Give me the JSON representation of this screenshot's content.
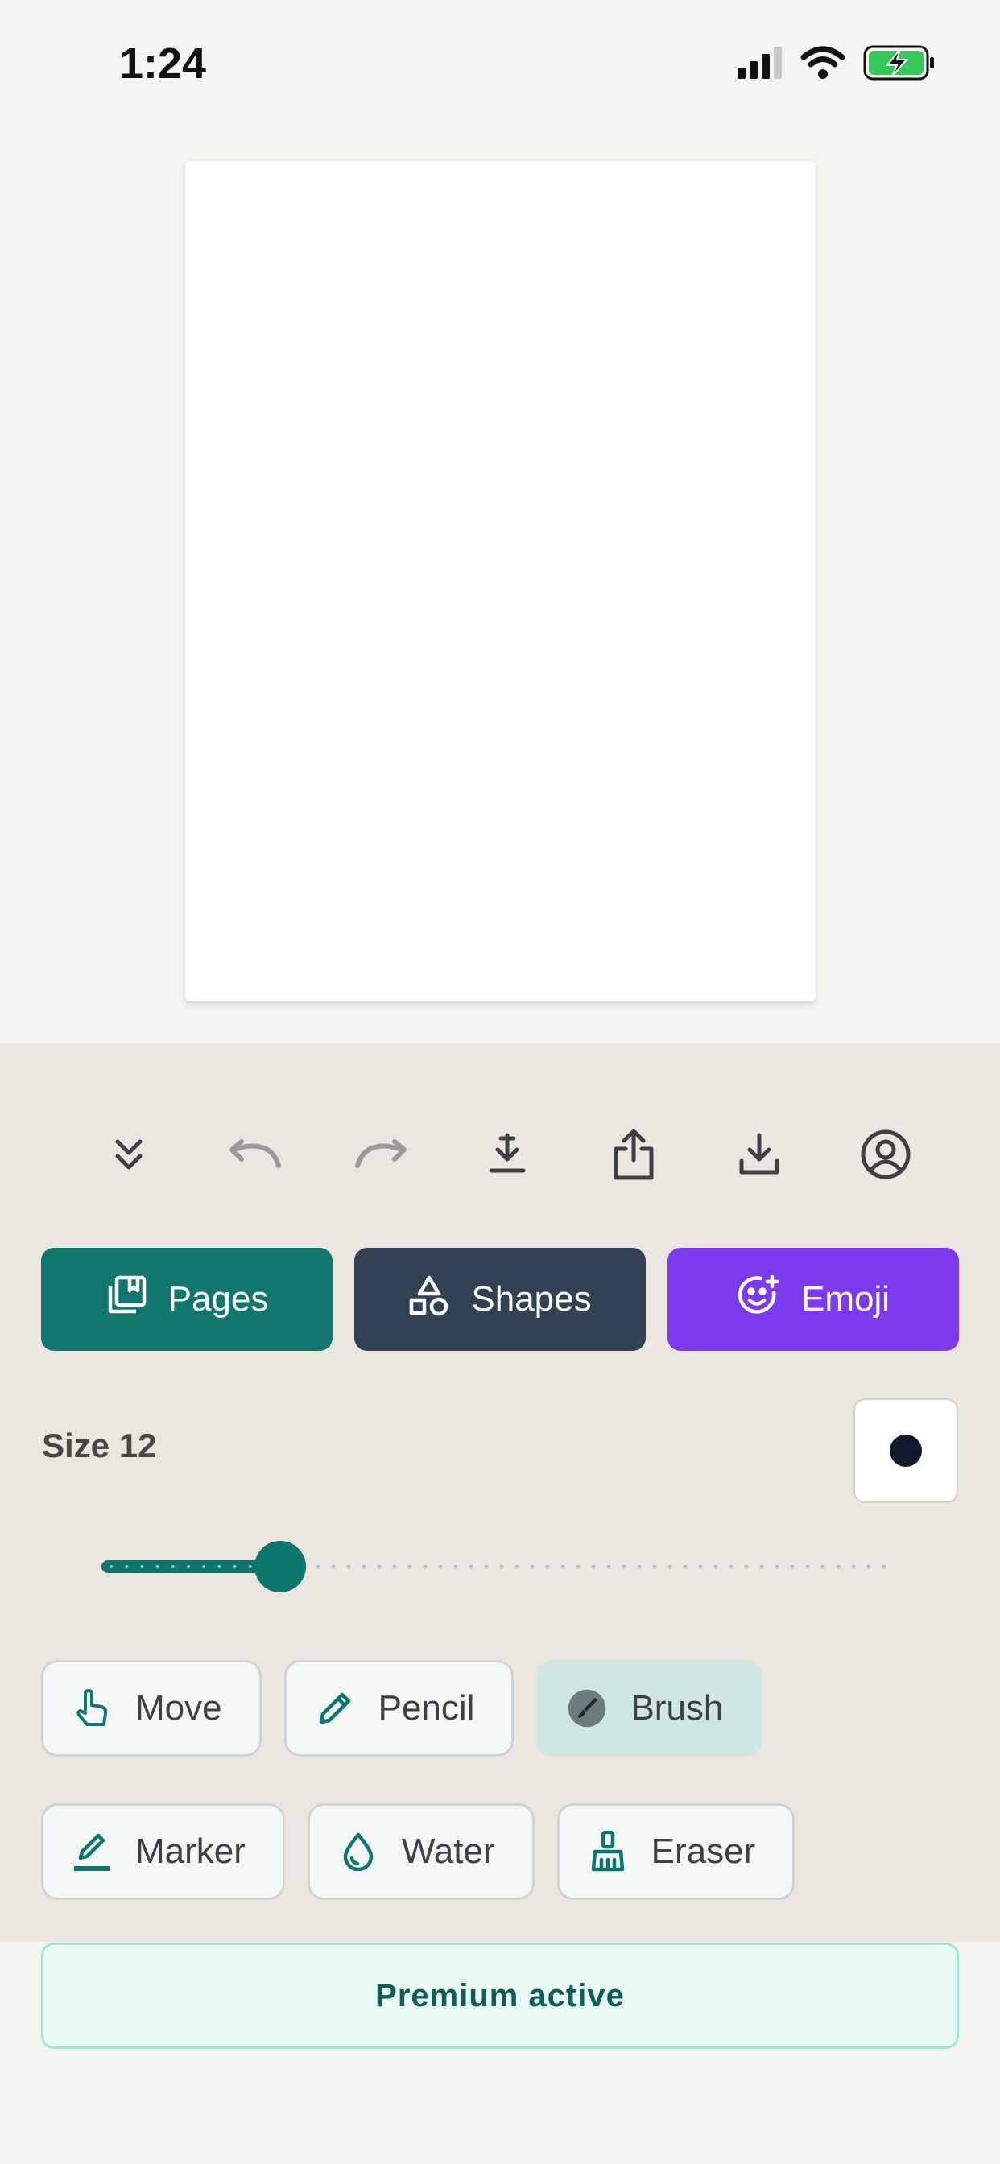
{
  "status_bar": {
    "time": "1:24"
  },
  "toolbar": {
    "icons": [
      "collapse-icon",
      "undo-icon",
      "redo-icon",
      "download-icon",
      "share-icon",
      "save-icon",
      "account-icon"
    ]
  },
  "actions": {
    "pages_label": "Pages",
    "shapes_label": "Shapes",
    "emoji_label": "Emoji"
  },
  "brush": {
    "size_label": "Size 12",
    "size_value": 12,
    "color": "#111827"
  },
  "tools": {
    "move": "Move",
    "pencil": "Pencil",
    "brush": "Brush",
    "marker": "Marker",
    "water": "Water",
    "eraser": "Eraser",
    "active": "Brush"
  },
  "premium": {
    "label": "Premium active"
  },
  "colors": {
    "teal": "#11766d",
    "slate": "#334155",
    "purple": "#7c3aed",
    "panel": "#ece6e0"
  }
}
